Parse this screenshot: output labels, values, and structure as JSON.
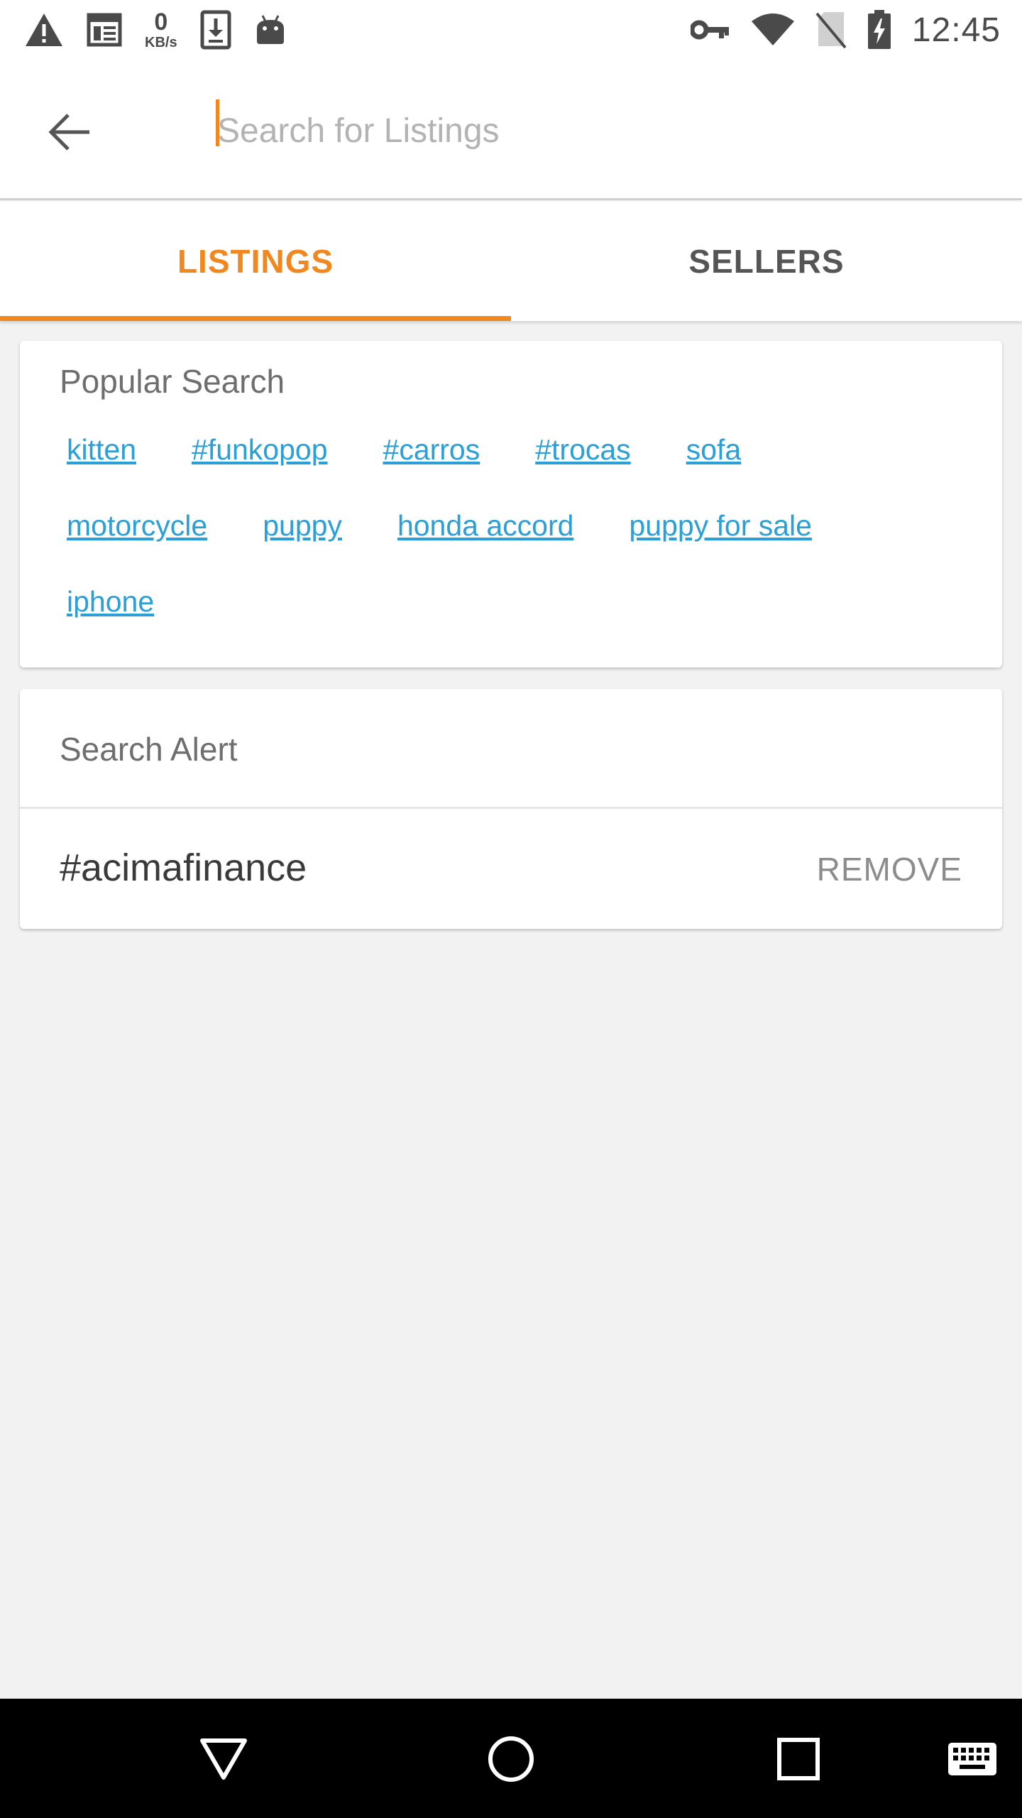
{
  "status_bar": {
    "network_speed_value": "0",
    "network_speed_unit": "KB/s",
    "time": "12:45",
    "left_icons": [
      "warning-icon",
      "news-icon",
      "download-icon",
      "android-icon"
    ],
    "right_icons": [
      "vpn-key-icon",
      "wifi-icon",
      "no-sim-icon",
      "battery-charging-icon"
    ]
  },
  "search": {
    "placeholder": "Search for Listings",
    "value": ""
  },
  "tabs": [
    {
      "label": "LISTINGS",
      "active": true
    },
    {
      "label": "SELLERS",
      "active": false
    }
  ],
  "colors": {
    "accent": "#f0881f",
    "link": "#2a9fd8"
  },
  "popular_search": {
    "title": "Popular Search",
    "rows": [
      [
        "kitten",
        "#funkopop",
        "#carros",
        "#trocas",
        "sofa"
      ],
      [
        "motorcycle",
        "puppy",
        "honda accord",
        "puppy for sale"
      ],
      [
        "iphone"
      ]
    ]
  },
  "search_alert": {
    "title": "Search Alert",
    "items": [
      {
        "term": "#acimafinance",
        "action": "REMOVE"
      }
    ]
  },
  "nav_bar": {
    "icons": [
      "back-triangle-icon",
      "home-circle-icon",
      "recents-square-icon",
      "keyboard-icon"
    ]
  }
}
